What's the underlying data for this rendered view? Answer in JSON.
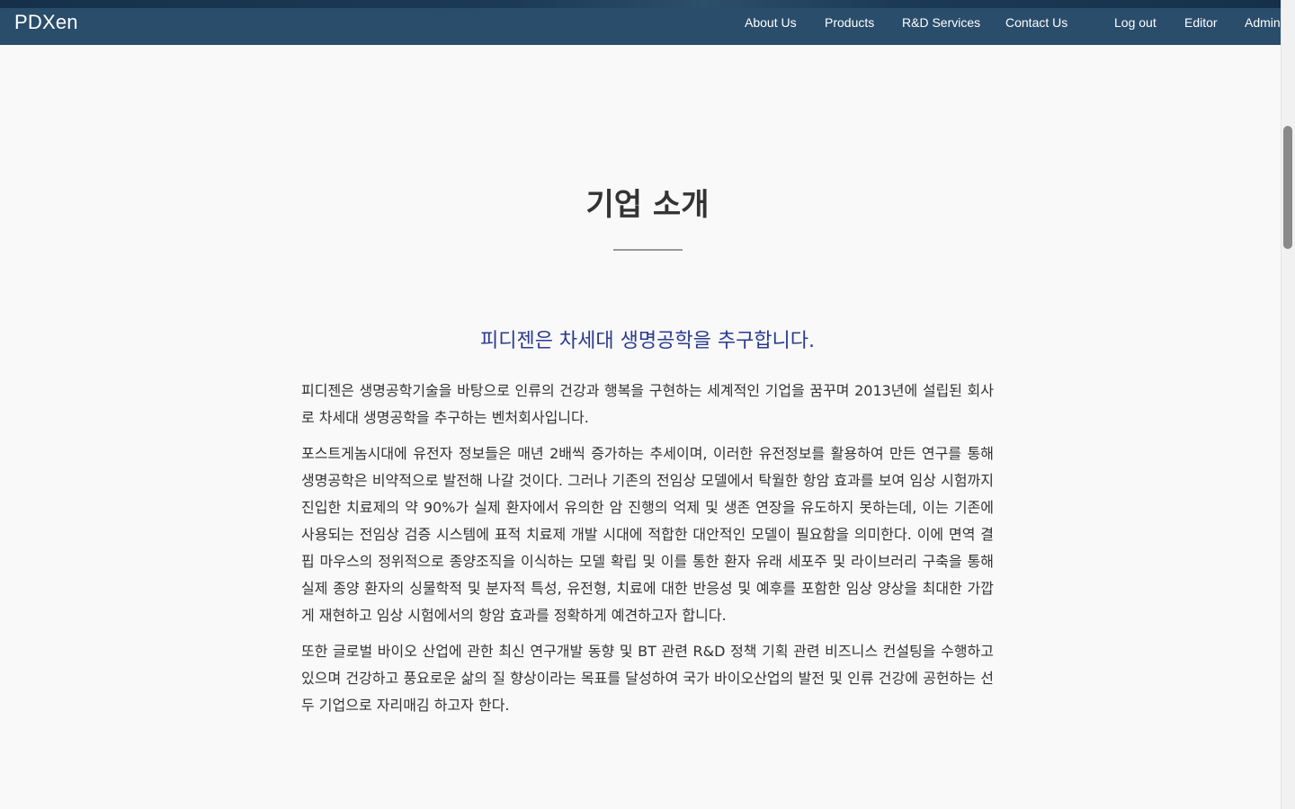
{
  "navbar": {
    "brand": "PDXen",
    "links": [
      {
        "label": "About Us"
      },
      {
        "label": "Products"
      },
      {
        "label": "R&D Services"
      },
      {
        "label": "Contact Us"
      },
      {
        "label": "Log out"
      },
      {
        "label": "Editor"
      },
      {
        "label": "Admin"
      }
    ]
  },
  "main": {
    "title": "기업 소개",
    "subtitle": "피디젠은 차세대 생명공학을 추구합니다.",
    "paragraphs": [
      "피디젠은 생명공학기술을 바탕으로 인류의 건강과 행복을 구현하는 세계적인 기업을 꿈꾸며 2013년에 설립된 회사로 차세대 생명공학을 추구하는 벤처회사입니다.",
      "포스트게놈시대에 유전자 정보들은 매년 2배씩 증가하는 추세이며, 이러한 유전정보를 활용하여 만든 연구를 통해 생명공학은 비약적으로 발전해 나갈 것이다. 그러나 기존의 전임상 모델에서 탁월한 항암 효과를 보여 임상 시험까지 진입한 치료제의 약 90%가 실제 환자에서 유의한 암 진행의 억제 및 생존 연장을 유도하지 못하는데, 이는 기존에 사용되는 전임상 검증 시스템에 표적 치료제 개발 시대에 적합한 대안적인 모델이 필요함을 의미한다. 이에 면역 결핍 마우스의 정위적으로 종양조직을 이식하는 모델 확립 및 이를 통한 환자 유래 세포주 및 라이브러리 구축을 통해 실제 종양 환자의 싱물학적 및 분자적 특성, 유전형, 치료에 대한 반응성 및 예후를 포함한 임상 양상을 최대한 가깝게 재현하고 임상 시험에서의 항암 효과를 정확하게 예견하고자 합니다.",
      "또한 글로벌 바이오 산업에 관한 최신 연구개발 동향 및 BT 관련 R&D 정책 기획 관련 비즈니스 컨설팅을 수행하고 있으며 건강하고 풍요로운 삶의 질 향상이라는 목표를 달성하여 국가 바이오산업의 발전 및 인류 건강에 공헌하는 선두 기업으로 자리매김 하고자 한다."
    ]
  },
  "colors": {
    "navbar": "#2a4d6b",
    "navbar_top": "#1a3550",
    "subtitle": "#2b3a8f",
    "body_text": "#333333",
    "background": "#f9f9f9"
  }
}
